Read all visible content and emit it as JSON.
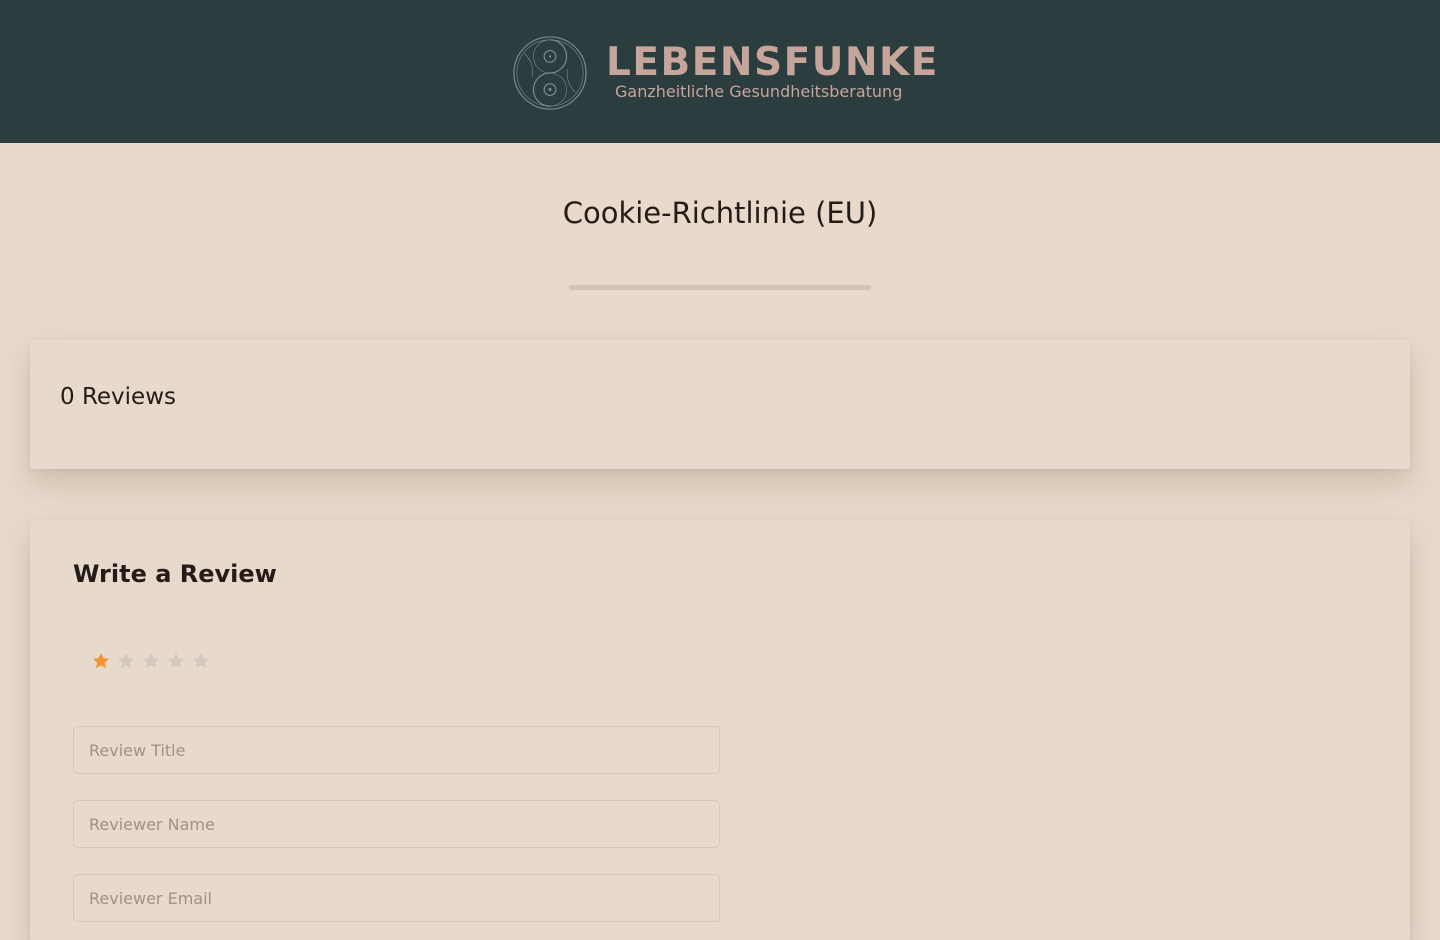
{
  "header": {
    "brand_name": "LEBENSFUNKE",
    "tagline": "Ganzheitliche Gesundheitsberatung",
    "background_color": "#2b3d3f",
    "brand_color": "#c6a59b",
    "logo_icon": "yin-yang-icon"
  },
  "page": {
    "title": "Cookie-Richtlinie (EU)",
    "background_color": "#e8d9cb"
  },
  "reviews": {
    "count_label": "0 Reviews"
  },
  "review_form": {
    "heading": "Write a Review",
    "rating": {
      "value": 1,
      "max": 5,
      "active_color": "#f39431",
      "inactive_color": "#d3c8bf",
      "star_icon": "star-icon"
    },
    "fields": {
      "title": {
        "placeholder": "Review Title",
        "value": ""
      },
      "name": {
        "placeholder": "Reviewer Name",
        "value": ""
      },
      "email": {
        "placeholder": "Reviewer Email",
        "value": ""
      }
    }
  }
}
